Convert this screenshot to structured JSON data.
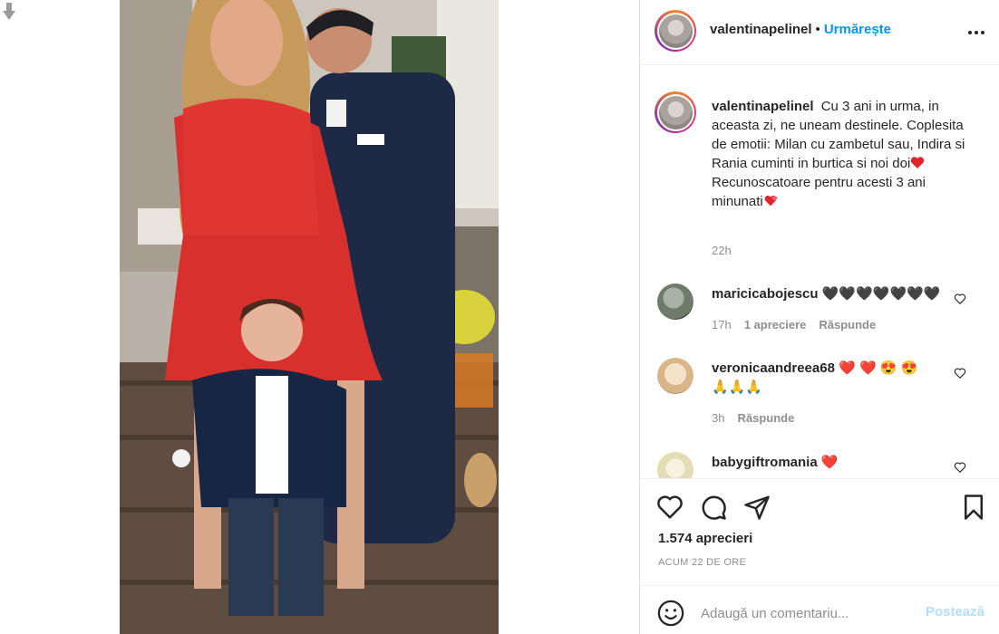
{
  "header": {
    "username": "valentinapelinel",
    "separator": "•",
    "follow_label": "Urmărește"
  },
  "caption": {
    "username": "valentinapelinel",
    "line1": "Cu 3 ani in urma, in aceasta zi, ne uneam destinele. Coplesita de emotii: Milan cu zambetul sau, Indira si Rania cuminti in burtica si noi doi",
    "line2": "Recunoscatoare pentru acesti 3 ani minunati",
    "time": "22h"
  },
  "comments": [
    {
      "username": "maricicabojescu",
      "text": "🖤🖤🖤🖤🖤🖤🖤",
      "time": "17h",
      "likes": "1 apreciere",
      "reply": "Răspunde"
    },
    {
      "username": "veronicaandreea68",
      "text": "❤️ ❤️ 😍 😍",
      "text2": "🙏🙏🙏",
      "time": "3h",
      "reply": "Răspunde"
    },
    {
      "username": "babygiftromania",
      "text": "❤️"
    }
  ],
  "actions": {
    "likes": "1.574 aprecieri",
    "post_time": "ACUM 22 DE ORE"
  },
  "add_comment": {
    "placeholder": "Adaugă un comentariu...",
    "post_label": "Postează"
  },
  "icons": {
    "more": "more-options-icon",
    "like": "heart-icon",
    "comment": "comment-icon",
    "share": "share-icon",
    "save": "bookmark-icon",
    "emoji": "emoji-icon"
  },
  "colors": {
    "accent": "#0095f6",
    "post_disabled": "#b2dffc",
    "muted": "#8e8e8e",
    "heart_red": "#ed4956"
  }
}
